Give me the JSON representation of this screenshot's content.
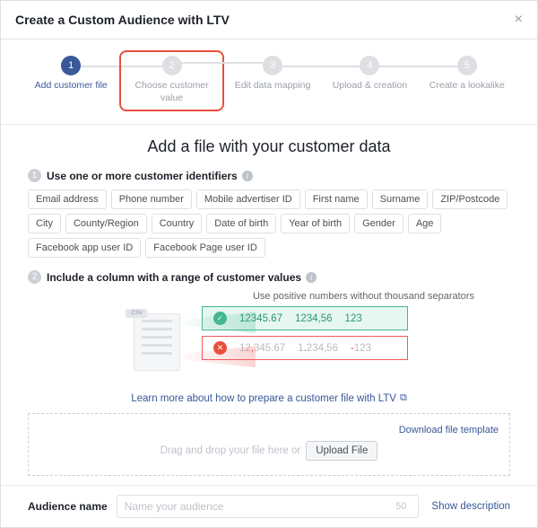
{
  "header": {
    "title": "Create a Custom Audience with LTV"
  },
  "steps": [
    {
      "num": "1",
      "label": "Add customer file"
    },
    {
      "num": "2",
      "label": "Choose customer value"
    },
    {
      "num": "3",
      "label": "Edit data mapping"
    },
    {
      "num": "4",
      "label": "Upload & creation"
    },
    {
      "num": "5",
      "label": "Create a lookalike"
    }
  ],
  "main_heading": "Add a file with your customer data",
  "section1": {
    "num": "1",
    "text": "Use one or more customer identifiers"
  },
  "tags": [
    "Email address",
    "Phone number",
    "Mobile advertiser ID",
    "First name",
    "Surname",
    "ZIP/Postcode",
    "City",
    "County/Region",
    "Country",
    "Date of birth",
    "Year of birth",
    "Gender",
    "Age",
    "Facebook app user ID",
    "Facebook Page user ID"
  ],
  "section2": {
    "num": "2",
    "text": "Include a column with a range of customer values"
  },
  "hint": "Use positive numbers without thousand separators",
  "good_values": [
    "12345.67",
    "1234,56",
    "123"
  ],
  "bad_values": [
    {
      "pre": "12",
      "accent": ",",
      "post": "345.67"
    },
    {
      "pre": "1",
      "accent": ".",
      "post": "234,56"
    },
    {
      "pre": "",
      "accent": "-",
      "post": "123"
    }
  ],
  "csv_tab": ".CSV",
  "learn_link": "Learn more about how to prepare a customer file with LTV",
  "dropzone": {
    "download": "Download file template",
    "drag_text": "Drag and drop your file here or",
    "upload_btn": "Upload File"
  },
  "footer": {
    "label": "Audience name",
    "placeholder": "Name your audience",
    "limit": "50",
    "show_desc": "Show description"
  }
}
